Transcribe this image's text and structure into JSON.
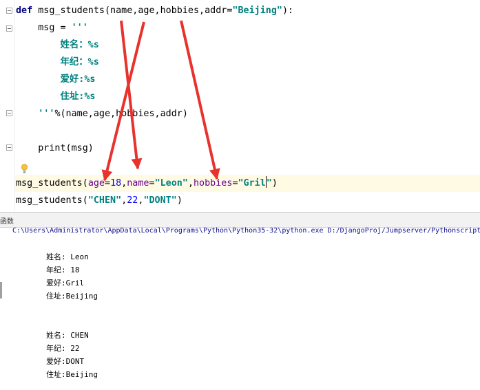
{
  "editor": {
    "lines": {
      "def_kw": "def",
      "def_name": " msg_students(name,age,hobbies,addr=",
      "def_default": "\"Beijing\"",
      "def_end": "):",
      "msg_assign": "    msg = ",
      "msg_open": "'''",
      "tpl1": "        姓名：%s",
      "tpl2": "        年纪：%s",
      "tpl3": "        爱好:%s",
      "tpl4": "        住址:%s",
      "tpl_close": "    '''",
      "tpl_args": "%(name,age,hobbies,addr)",
      "print_line": "    print(msg)",
      "call1_fn": "msg_students(",
      "call1_age_kw": "age",
      "call1_eq1": "=",
      "call1_age_val": "18",
      "call1_mid1": ",",
      "call1_name_kw": "name",
      "call1_eq2": "=",
      "call1_name_val": "\"Leon\"",
      "call1_mid2": ",",
      "call1_hob_kw": "hobbies",
      "call1_eq3": "=",
      "call1_hob_val": "\"Gril",
      "call1_hob_close": "\"",
      "call1_end": ")",
      "call2_fn": "msg_students(",
      "call2_a": "\"CHEN\"",
      "call2_c1": ",",
      "call2_b": "22",
      "call2_c2": ",",
      "call2_c": "\"DONT\"",
      "call2_end": ")"
    }
  },
  "run_panel": {
    "tab_label": "函数",
    "command": "C:\\Users\\Administrator\\AppData\\Local\\Programs\\Python\\Python35-32\\python.exe D:/DjangoProj/Jumpserver/Pythonscript"
  },
  "output": [
    "姓名: Leon",
    "年纪: 18",
    "爱好:Gril",
    "住址:Beijing",
    "姓名: CHEN",
    "年纪: 22",
    "爱好:DONT",
    "住址:Beijing"
  ],
  "colors": {
    "keyword": "#000080",
    "string": "#008080",
    "number": "#0000ff",
    "param": "#660099",
    "arrow": "#e8322e",
    "highlight": "#fffae3"
  }
}
